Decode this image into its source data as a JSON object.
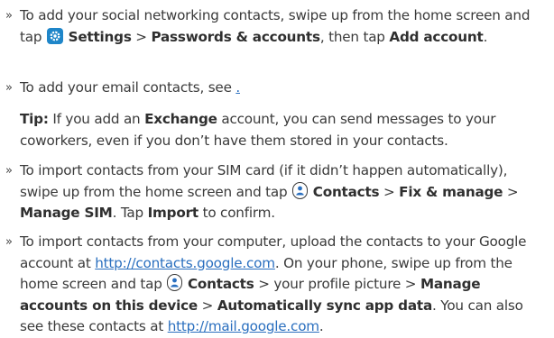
{
  "item1": {
    "bullet": "»",
    "t1": "To add your social networking contacts, swipe up from the home screen and tap ",
    "settings": "Settings",
    "gt1": " > ",
    "passwords": "Passwords & accounts",
    "t2": ", then tap ",
    "add_account": "Add account",
    "end": "."
  },
  "item2": {
    "bullet": "»",
    "t1": "To add your email contacts, see ",
    "link": ".",
    "end": ""
  },
  "tip": {
    "label": "Tip:",
    "t1": " If you add an ",
    "exchange": "Exchange",
    "t2": " account, you can send messages to your coworkers, even if you don’t have them stored in your contacts."
  },
  "item3": {
    "bullet": "»",
    "t1": "To import contacts from your SIM card (if it didn’t happen automatically), swipe up from the home screen and tap ",
    "contacts": "Contacts",
    "gt1": " > ",
    "fix": "Fix & manage",
    "gt2": " > ",
    "sim": "Manage SIM",
    "t2": ". Tap ",
    "import": "Import",
    "t3": " to confirm."
  },
  "item4": {
    "bullet": "»",
    "t1": "To import contacts from your computer, upload the contacts to your Google account at ",
    "link1": "http://contacts.google.com",
    "t2": ". On your phone, swipe up from the home screen and tap ",
    "contacts": "Contacts",
    "t3": " > your profile picture > ",
    "manage": "Manage accounts on this device",
    "gt": " > ",
    "sync": "Automatically sync app data",
    "t4": ". You can also see these contacts at ",
    "link2": "http://mail.google.com",
    "t5": "."
  }
}
